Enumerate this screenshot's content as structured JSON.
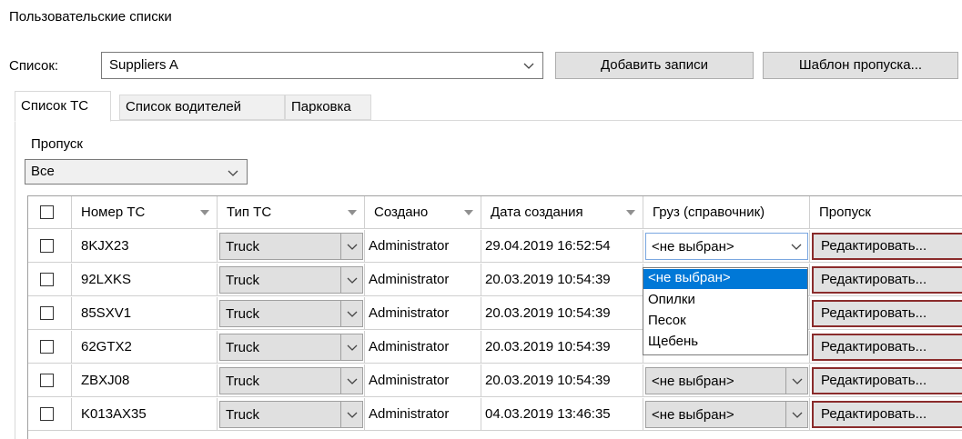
{
  "page_title": "Пользовательские списки",
  "list_selector": {
    "label": "Список:",
    "value": "Suppliers A"
  },
  "buttons": {
    "add_records": "Добавить записи",
    "pass_template": "Шаблон пропуска..."
  },
  "tabs": [
    {
      "label": "Список ТС",
      "active": true
    },
    {
      "label": "Список водителей",
      "active": false
    },
    {
      "label": "Парковка",
      "active": false
    }
  ],
  "pass_filter": {
    "label": "Пропуск",
    "value": "Все"
  },
  "table": {
    "columns": [
      "Номер ТС",
      "Тип ТС",
      "Создано",
      "Дата создания",
      "Груз (справочник)",
      "Пропуск"
    ],
    "rows": [
      {
        "number": "8KJX23",
        "type": "Truck",
        "created_by": "Administrator",
        "date": "29.04.2019 16:52:54",
        "cargo": "<не выбран>",
        "pass": "Редактировать..."
      },
      {
        "number": "92LXKS",
        "type": "Truck",
        "created_by": "Administrator",
        "date": "20.03.2019 10:54:39",
        "cargo": "",
        "pass": "Редактировать..."
      },
      {
        "number": "85SXV1",
        "type": "Truck",
        "created_by": "Administrator",
        "date": "20.03.2019 10:54:39",
        "cargo": "",
        "pass": "Редактировать..."
      },
      {
        "number": "62GTX2",
        "type": "Truck",
        "created_by": "Administrator",
        "date": "20.03.2019 10:54:39",
        "cargo": "",
        "pass": "Редактировать..."
      },
      {
        "number": "ZBXJ08",
        "type": "Truck",
        "created_by": "Administrator",
        "date": "20.03.2019 10:54:39",
        "cargo": "<не выбран>",
        "pass": "Редактировать..."
      },
      {
        "number": "K013AX35",
        "type": "Truck",
        "created_by": "Administrator",
        "date": "04.03.2019 13:46:35",
        "cargo": "<не выбран>",
        "pass": "Редактировать..."
      }
    ]
  },
  "cargo_dropdown": {
    "options": [
      "<не выбран>",
      "Опилки",
      "Песок",
      "Щебень"
    ],
    "selected": "<не выбран>"
  },
  "colors": {
    "selection": "#0078d7",
    "edit_border": "#8a2b2b"
  },
  "icons": {
    "combo": "chevron-down-icon",
    "sort": "sort-arrow-icon",
    "checkbox": "checkbox-icon"
  }
}
